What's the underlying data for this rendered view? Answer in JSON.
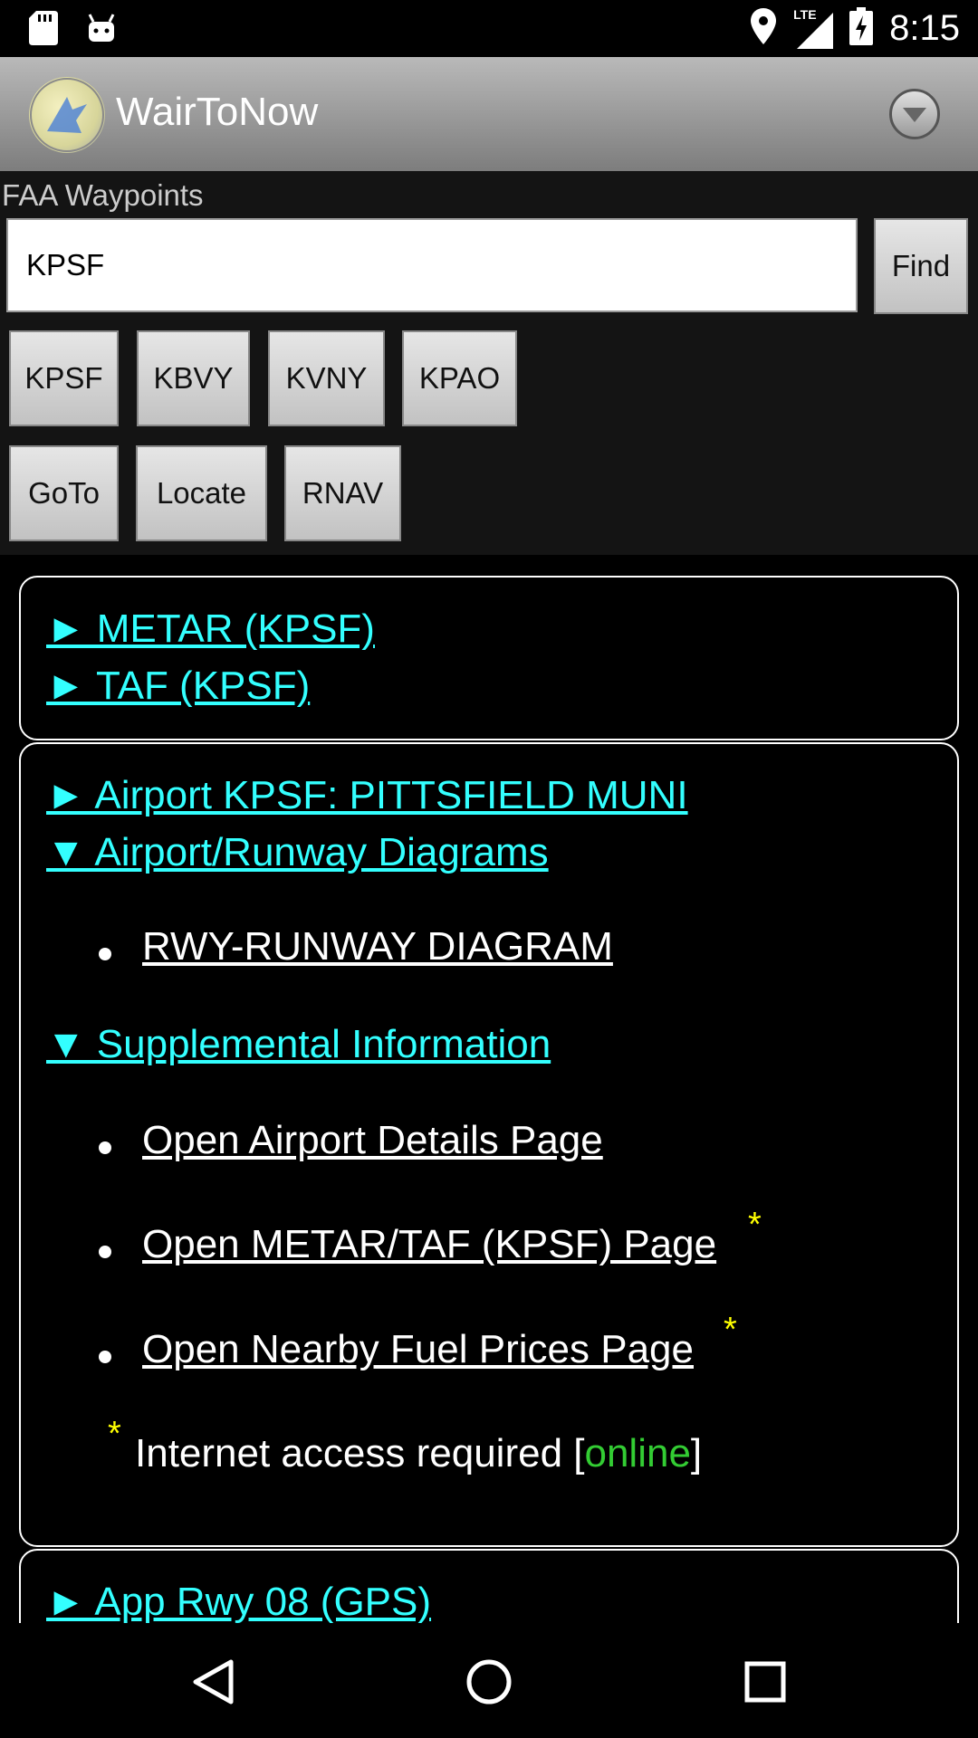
{
  "status_bar": {
    "time": "8:15",
    "network": "LTE",
    "icons": [
      "sd-card-icon",
      "android-icon",
      "location-icon",
      "signal-icon",
      "battery-charging-icon"
    ]
  },
  "action_bar": {
    "title": "WairToNow",
    "overflow_icon": "chevron-down-circle-icon"
  },
  "search": {
    "label": "FAA Waypoints",
    "value": "KPSF",
    "find_label": "Find"
  },
  "recent_buttons": [
    "KPSF",
    "KBVY",
    "KVNY",
    "KPAO"
  ],
  "action_buttons": [
    "GoTo",
    "Locate",
    "RNAV"
  ],
  "weather_box": {
    "metar": "► METAR (KPSF)",
    "taf": "► TAF (KPSF)"
  },
  "airport_box": {
    "airport_link": "► Airport KPSF: PITTSFIELD MUNI",
    "diagrams_link": "▼ Airport/Runway Diagrams",
    "diagram_items": [
      "RWY-RUNWAY DIAGRAM"
    ],
    "supplemental_link": "▼ Supplemental Information",
    "supplemental_items": [
      "Open Airport Details Page",
      "Open METAR/TAF (KPSF) Page",
      "Open Nearby Fuel Prices Page"
    ],
    "star": "*",
    "note_text": "Internet access required [",
    "note_status": "online",
    "note_end": "]"
  },
  "approach_box": {
    "approach_link": "► App Rwy 08 (GPS)"
  },
  "colors": {
    "link": "#33ffff",
    "star": "#ffff00",
    "online": "#33cc33"
  }
}
